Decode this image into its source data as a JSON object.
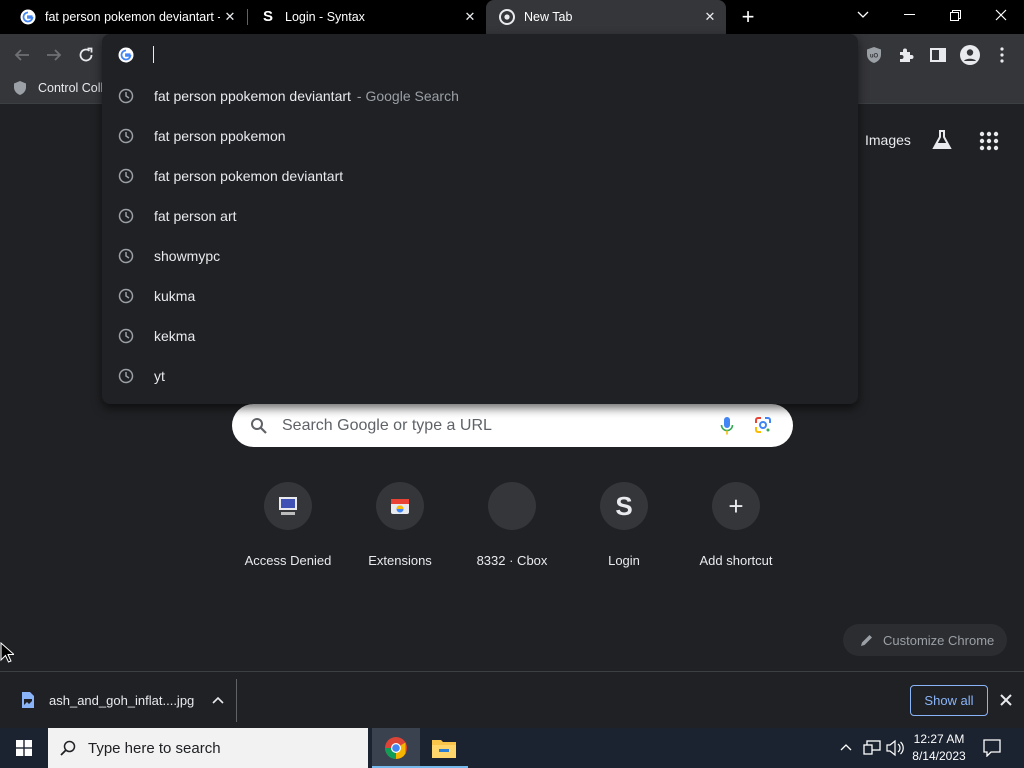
{
  "tabs": [
    {
      "title": "fat person pokemon deviantart -",
      "icon": "google-g-icon"
    },
    {
      "title": "Login - Syntax",
      "icon": "syntax-s-icon"
    },
    {
      "title": "New Tab",
      "icon": "chrome-icon"
    }
  ],
  "bookmarks": {
    "first": "Control Coll"
  },
  "omnibox": {
    "suggestions": [
      {
        "text": "fat person ppokemon deviantart",
        "suffix": "- Google Search"
      },
      {
        "text": "fat person ppokemon",
        "suffix": ""
      },
      {
        "text": "fat person pokemon deviantart",
        "suffix": ""
      },
      {
        "text": "fat person art",
        "suffix": ""
      },
      {
        "text": "showmypc",
        "suffix": ""
      },
      {
        "text": "kukma",
        "suffix": ""
      },
      {
        "text": "kekma",
        "suffix": ""
      },
      {
        "text": "yt",
        "suffix": ""
      }
    ]
  },
  "ntp": {
    "images_link": "Images",
    "search_placeholder": "Search Google or type a URL",
    "shortcuts": [
      {
        "label": "Access Denied",
        "icon": "computer-icon",
        "glyph": ""
      },
      {
        "label": "Extensions",
        "icon": "extensions-store-icon",
        "glyph": ""
      },
      {
        "label": "8332 · Cbox",
        "icon": "blank-site-icon",
        "glyph": ""
      },
      {
        "label": "Login",
        "icon": "syntax-s-icon",
        "glyph": "S"
      },
      {
        "label": "Add shortcut",
        "icon": "plus-icon",
        "glyph": "+"
      }
    ],
    "customize": "Customize Chrome"
  },
  "downloads": {
    "file": "ash_and_goh_inflat....jpg",
    "show_all": "Show all"
  },
  "taskbar": {
    "search_placeholder": "Type here to search",
    "time": "12:27 AM",
    "date": "8/14/2023"
  },
  "colors": {
    "accent": "#8ab4f8",
    "taskbar": "#1b2330",
    "toolbar": "#35363a"
  }
}
